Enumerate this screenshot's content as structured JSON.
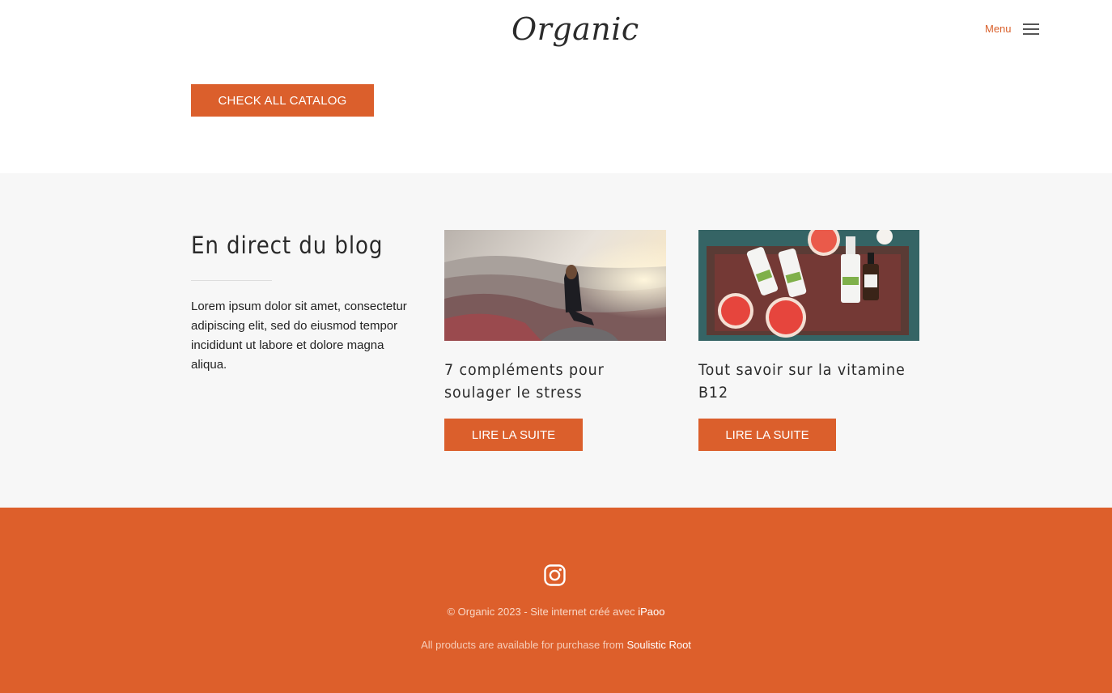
{
  "header": {
    "logo": "Organic",
    "menu_label": "Menu",
    "catalog_button": "CHECK ALL CATALOG"
  },
  "blog": {
    "title": "En direct du blog",
    "description": "Lorem ipsum dolor sit amet, consectetur adipiscing elit, sed do eiusmod tempor incididunt ut labore et dolore magna aliqua.",
    "posts": [
      {
        "title": "7 compléments pour soulager le stress",
        "button": "LIRE LA SUITE",
        "image": "woman-on-mountain-photo"
      },
      {
        "title": "Tout savoir sur la vitamine B12",
        "button": "LIRE LA SUITE",
        "image": "serum-bottles-grapefruit-photo"
      }
    ]
  },
  "footer": {
    "social_icon": "instagram-icon",
    "copyright": "© Organic 2023 - Site internet créé avec",
    "copyright_link": "iPaoo",
    "availability": "All products are available for purchase from",
    "availability_link": "Soulistic Root"
  },
  "colors": {
    "accent": "#db5f2c",
    "blog_background": "#f7f7f7",
    "footer_background": "#dd5f2b"
  }
}
